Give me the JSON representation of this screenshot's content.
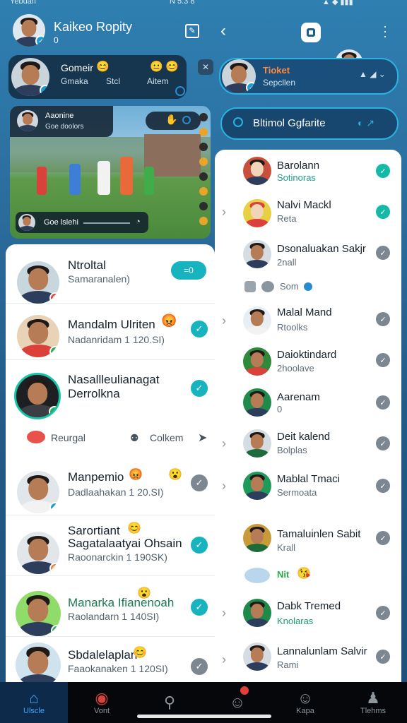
{
  "status_bar": {
    "time_left": "Yebuan",
    "time_right": "N 5:3 8"
  },
  "left_header": {
    "title": "Kaikeo Ropity",
    "subtitle": "0"
  },
  "right_header": {
    "back_label": "back"
  },
  "left_top_card": {
    "name": "Gomeir",
    "sub": "Gmaka",
    "sub2": "Stcl",
    "sub3": "Aitem"
  },
  "right_top_card": {
    "name": "Tioket",
    "sub": "Sepcllen"
  },
  "video_card": {
    "host_name": "Aaonine",
    "host_sub": "Goe doolors",
    "caption": "Goe lslehi"
  },
  "right_search": {
    "value": "Bltimol Ggfarite"
  },
  "left_list": [
    {
      "name": "Ntroltal",
      "sub": "Samaranalen)",
      "action": "=0"
    },
    {
      "name": "Mandalm Ulriten",
      "sub": "Nadanridam 1 120.SI)"
    },
    {
      "name": "Nasallleulianagat",
      "name2": "Derrolkna",
      "sub": ""
    },
    {
      "name": "Manpemio",
      "sub": "Dadlaahakan 1 20.SI)"
    },
    {
      "name": "Sarortiant",
      "name2": "Sagatalaatyai Ohsain",
      "sub": "Raoonarckin 1 190SK)"
    },
    {
      "name": "Manarka Ifianenoah",
      "sub": "Raolandarn 1 140SI)"
    },
    {
      "name": "Sbdalelaplan",
      "sub": "Faaokanaken 1 120SI)"
    }
  ],
  "left_filters": {
    "f1": "Reurgal",
    "f2": "Colkem"
  },
  "right_list": [
    {
      "name": "Barolann",
      "sub": "Sotinoras"
    },
    {
      "name": "Nalvi Mackl",
      "sub": "Reta"
    },
    {
      "name": "Dsonaluakan Sakjr",
      "sub": "2nall"
    },
    {
      "name": "Malal Mand",
      "sub": "Rtoolks"
    },
    {
      "name": "Daioktindard",
      "sub": "2hoolave"
    },
    {
      "name": "Aarenam",
      "sub": "0"
    },
    {
      "name": "Deit kalend",
      "sub": "Bolplas"
    },
    {
      "name": "Mablal Tmaci",
      "sub": "Sermoata"
    },
    {
      "name": "Tamaluinlen Sabit",
      "sub": "Krall"
    },
    {
      "name": "Dabk Tremed",
      "sub": "Knolaras"
    },
    {
      "name": "Lannalunlam Salvir",
      "sub": "Rami"
    }
  ],
  "right_divider1": {
    "label": "Som"
  },
  "right_divider2": {
    "label": "Nit"
  },
  "nav": [
    {
      "label": "Ulscle"
    },
    {
      "label": "Vont"
    },
    {
      "label": ""
    },
    {
      "label": ""
    },
    {
      "label": "Kapa"
    },
    {
      "label": "Tlehms"
    }
  ],
  "colors": {
    "accent": "#17b3be",
    "header_bg": "#2f7fb1",
    "nav_active": "#0d2a4a"
  }
}
